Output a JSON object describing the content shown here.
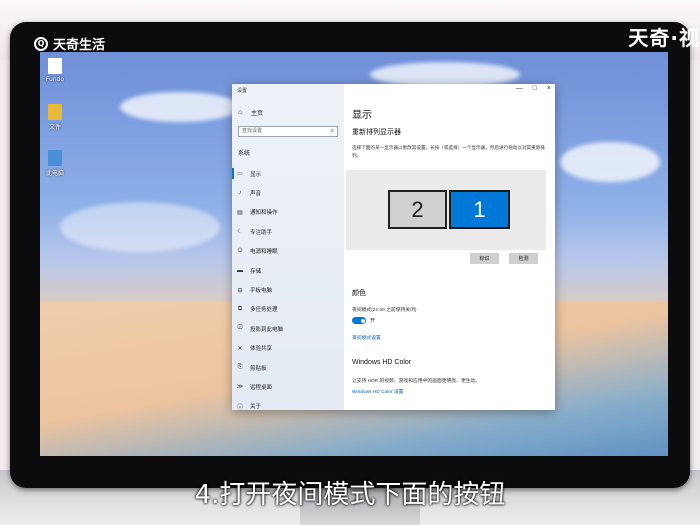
{
  "watermark": {
    "left": "天奇生活",
    "right": "天奇·视"
  },
  "desktop_icons": [
    {
      "label": "Fundo",
      "color": "#ffffff"
    },
    {
      "label": "文件",
      "color": "#e8b93b"
    },
    {
      "label": "此电脑",
      "color": "#4a90d9"
    }
  ],
  "window": {
    "title": "设置",
    "controls": [
      "—",
      "□",
      "×"
    ],
    "home": "主页",
    "search_placeholder": "查找设置",
    "section": "系统",
    "nav_items": [
      {
        "icon": "▭",
        "label": "显示",
        "active": true
      },
      {
        "icon": "♪",
        "label": "声音",
        "active": false
      },
      {
        "icon": "▤",
        "label": "通知和操作",
        "active": false
      },
      {
        "icon": "☾",
        "label": "专注助手",
        "active": false
      },
      {
        "icon": "⏻",
        "label": "电源和睡眠",
        "active": false
      },
      {
        "icon": "▬",
        "label": "存储",
        "active": false
      },
      {
        "icon": "⊟",
        "label": "平板电脑",
        "active": false
      },
      {
        "icon": "⧉",
        "label": "多任务处理",
        "active": false
      },
      {
        "icon": "⎚",
        "label": "投影到此电脑",
        "active": false
      },
      {
        "icon": "✕",
        "label": "体验共享",
        "active": false
      },
      {
        "icon": "⎘",
        "label": "剪贴板",
        "active": false
      },
      {
        "icon": "≫",
        "label": "远程桌面",
        "active": false
      },
      {
        "icon": "ⓘ",
        "label": "关于",
        "active": false
      }
    ]
  },
  "main": {
    "title": "显示",
    "arrange_heading": "重新排列显示器",
    "arrange_desc": "选择下面的某一显示器以更改其设置。长按（或选择）一个显示器，然后进行拖动以对其重新排列。",
    "monitor_left": "2",
    "monitor_right": "1",
    "identify_btn": "标识",
    "detect_btn": "检测",
    "color_heading": "颜色",
    "night_label": "夜间模式(21:00 之前保持关闭)",
    "toggle_state": "开",
    "night_link": "夜间模式设置",
    "hdr_heading": "Windows HD Color",
    "hdr_desc": "让支持 HDR 的视频、游戏和应用中的画面更明亮、更生动。",
    "hdr_link": "Windows HD Color 设置"
  },
  "caption": "4.打开夜间模式下面的按钮"
}
